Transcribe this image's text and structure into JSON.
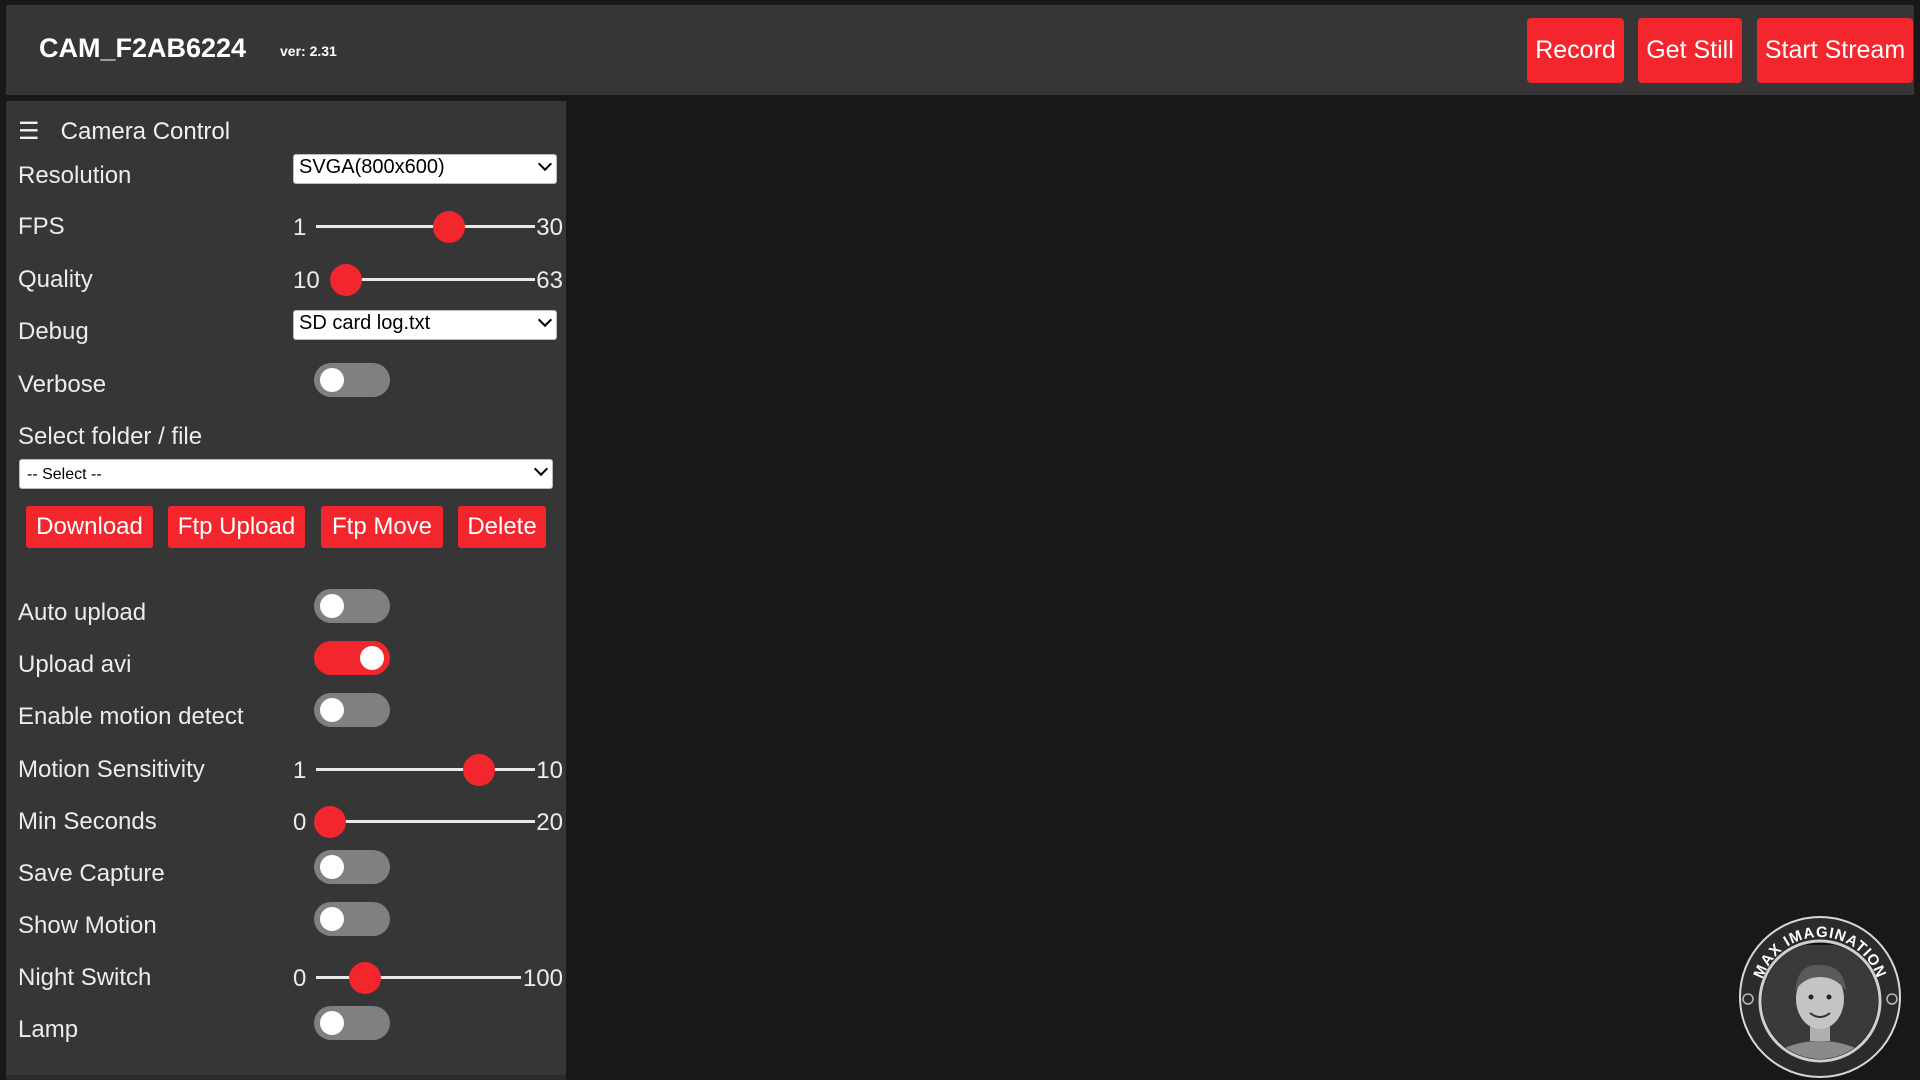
{
  "header": {
    "camera_name": "CAM_F2AB6224",
    "version": "ver: 2.31",
    "buttons": {
      "record": "Record",
      "get_still": "Get Still",
      "start_stream": "Start Stream"
    }
  },
  "panel": {
    "title": "Camera Control",
    "menu_icon": "☰",
    "resolution": {
      "label": "Resolution",
      "value": "SVGA(800x600)"
    },
    "fps": {
      "label": "FPS",
      "min": "1",
      "max": "30",
      "value": 19
    },
    "quality": {
      "label": "Quality",
      "min": "10",
      "max": "63",
      "value": 10
    },
    "debug": {
      "label": "Debug",
      "value": "SD card log.txt"
    },
    "verbose": {
      "label": "Verbose",
      "on": false
    },
    "folder": {
      "label": "Select folder / file",
      "value": "-- Select --"
    },
    "file_buttons": {
      "download": "Download",
      "ftp_upload": "Ftp Upload",
      "ftp_move": "Ftp Move",
      "delete": "Delete"
    },
    "auto_upload": {
      "label": "Auto upload",
      "on": false
    },
    "upload_avi": {
      "label": "Upload avi",
      "on": true
    },
    "motion_detect": {
      "label": "Enable motion detect",
      "on": false
    },
    "motion_sensitivity": {
      "label": "Motion Sensitivity",
      "min": "1",
      "max": "10",
      "value": 8
    },
    "min_seconds": {
      "label": "Min Seconds",
      "min": "0",
      "max": "20",
      "value": 0
    },
    "save_capture": {
      "label": "Save Capture",
      "on": false
    },
    "show_motion": {
      "label": "Show Motion",
      "on": false
    },
    "night_switch": {
      "label": "Night Switch",
      "min": "0",
      "max": "100",
      "value": 20
    },
    "lamp": {
      "label": "Lamp",
      "on": false
    }
  },
  "logo": {
    "text": "MAX IMAGINATION"
  },
  "colors": {
    "accent": "#f3262e",
    "background": "#181818",
    "panel": "#363636",
    "toggle_off": "#808080"
  }
}
